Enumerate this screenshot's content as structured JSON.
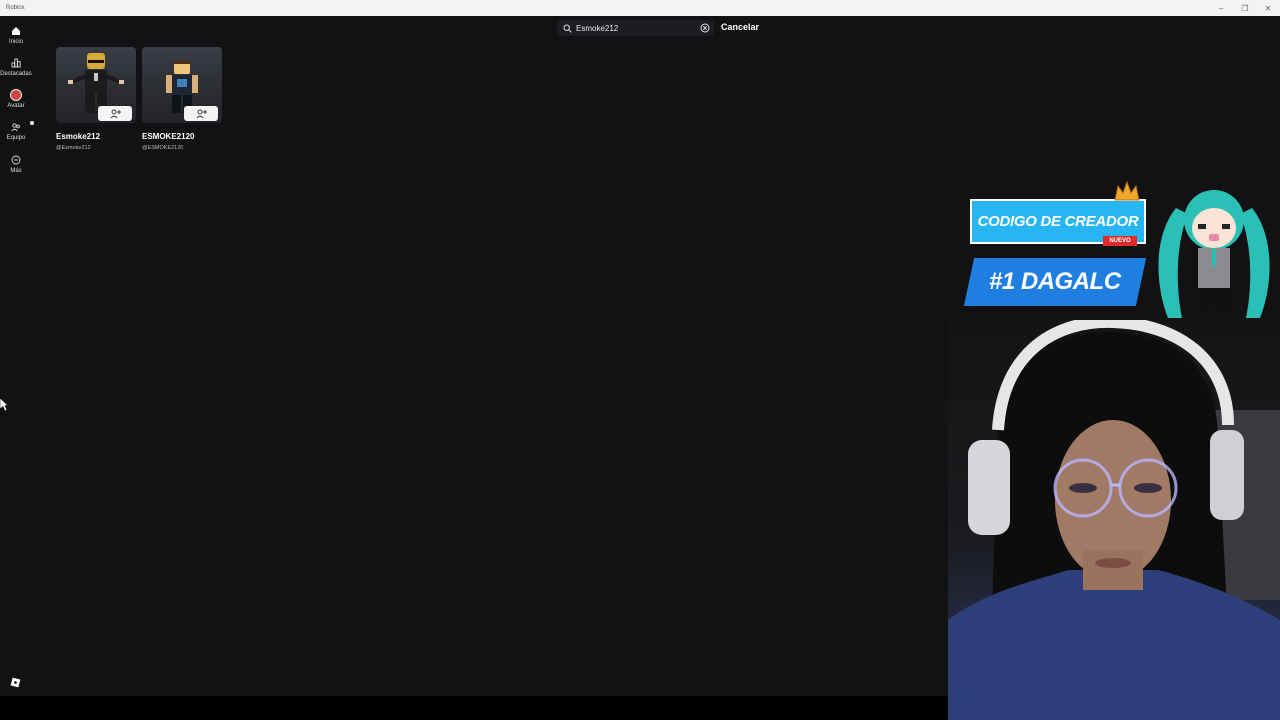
{
  "window": {
    "title": "Roblox"
  },
  "sidebar": {
    "items": [
      {
        "label": "Inicio",
        "icon": "home-icon"
      },
      {
        "label": "Destacadas",
        "icon": "charts-icon"
      },
      {
        "label": "Avatar",
        "icon": "avatar-icon"
      },
      {
        "label": "Equipo",
        "icon": "party-icon"
      },
      {
        "label": "Más",
        "icon": "more-icon"
      }
    ]
  },
  "search": {
    "value": "Esmoke212",
    "cancel_label": "Cancelar"
  },
  "results": [
    {
      "name": "Esmoke212",
      "handle": "@Esmoke212"
    },
    {
      "name": "ESMOKE2120",
      "handle": "@ESMOKE2120"
    }
  ],
  "overlay": {
    "banner_top": "CODIGO DE CREADOR",
    "banner_tag": "NUEVO",
    "banner_bottom": "#1 DAGALC"
  },
  "colors": {
    "background": "#121214",
    "accent_blue": "#1e9be8",
    "titlebar": "#f3f3f3"
  }
}
